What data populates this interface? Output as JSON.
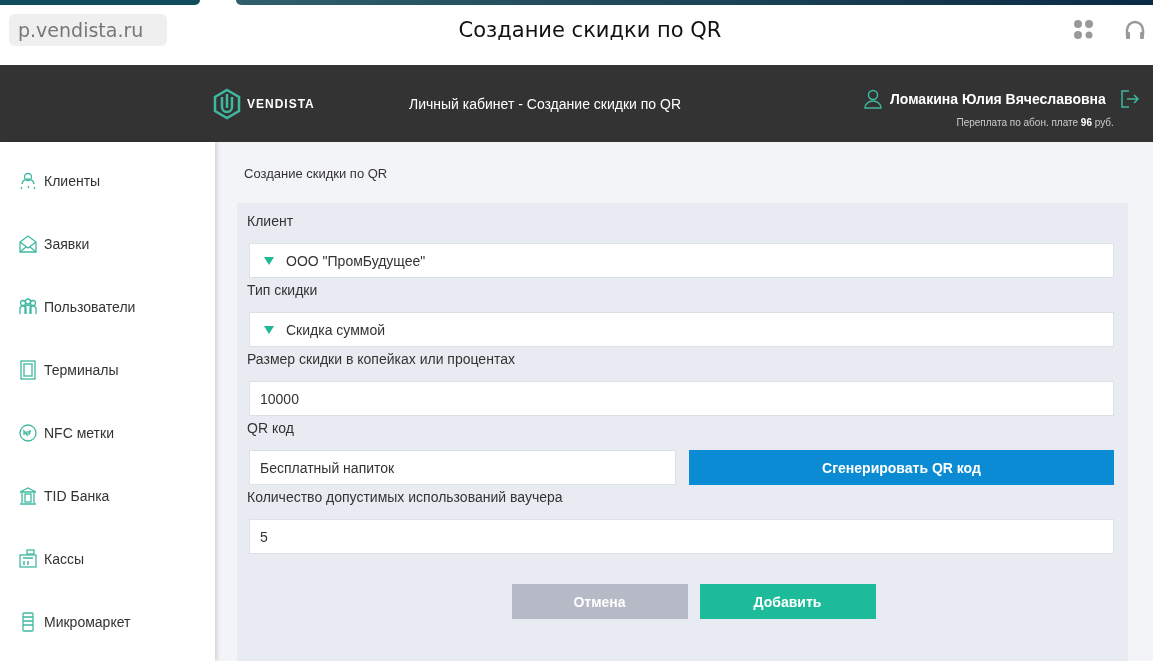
{
  "browser": {
    "address": "p.vendista.ru",
    "title": "Создание скидки по QR"
  },
  "header": {
    "logo": "VENDISTA",
    "page_title": "Личный кабинет - Создание скидки по QR",
    "user": "Ломакина Юлия Вячеславовна",
    "balance": "Переплата по абон. плате **96** руб."
  },
  "sidebar": {
    "items": [
      {
        "label": "Клиенты",
        "selected": false
      },
      {
        "label": "Заявки",
        "selected": false
      },
      {
        "label": "Пользователи",
        "selected": false
      },
      {
        "label": "Терминалы",
        "selected": false
      },
      {
        "label": "NFC метки",
        "selected": false
      },
      {
        "label": "TID Банка",
        "selected": false
      },
      {
        "label": "Кассы",
        "selected": false
      },
      {
        "label": "Микромаркет",
        "selected": false
      }
    ]
  },
  "content": {
    "title": "Создание скидки по QR",
    "fields": [
      {
        "kind": "select",
        "label": "Клиент",
        "value": "ООО \"ПромБудущее\""
      },
      {
        "kind": "select",
        "label": "Тип скидки",
        "value": "Скидка суммой"
      },
      {
        "kind": "input",
        "label": "Размер скидки в копейках или процентах",
        "value": "10000"
      },
      {
        "kind": "input_button",
        "label": "QR код",
        "value": "Бесплатный напиток",
        "button": "Сгенерировать QR код"
      },
      {
        "kind": "input",
        "label": "Количество допустимых использований ваучера",
        "value": "5"
      }
    ],
    "buttons": [
      {
        "label": "Отмена",
        "disabled": true
      },
      {
        "label": "Добавить",
        "disabled": false
      }
    ]
  }
}
